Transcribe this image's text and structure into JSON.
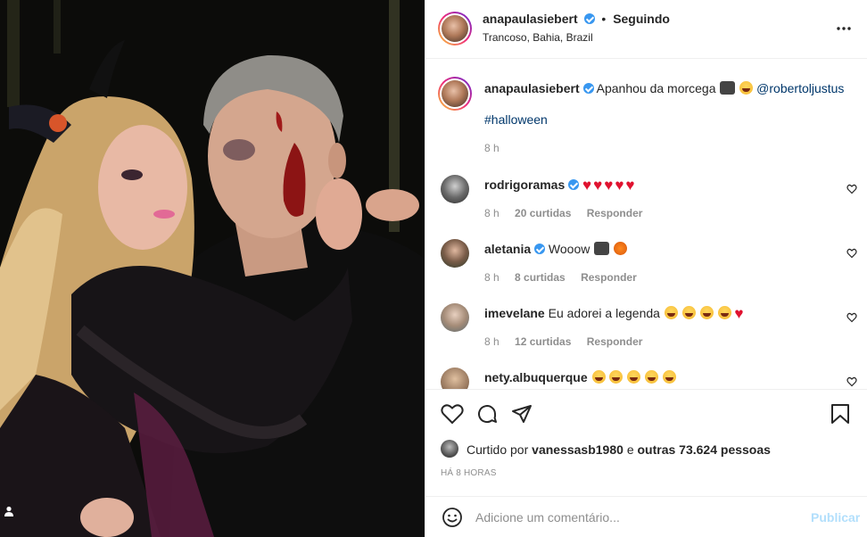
{
  "post": {
    "author": "anapaulasiebert",
    "follow_status": "Seguindo",
    "location": "Trancoso, Bahia, Brazil",
    "caption_text": "Apanhou da morcega",
    "caption_mention": "@robertoljustus",
    "caption_hashtag": "#halloween",
    "caption_time": "8 h"
  },
  "comments": [
    {
      "user": "rodrigoramas",
      "verified": true,
      "text": "",
      "emojis": [
        "red-heart",
        "red-heart",
        "red-heart",
        "red-heart",
        "red-heart"
      ],
      "time": "8 h",
      "likes": "20 curtidas",
      "reply": "Responder"
    },
    {
      "user": "aletania",
      "verified": true,
      "text": "Wooow",
      "emojis": [
        "bat",
        "pumpkin"
      ],
      "time": "8 h",
      "likes": "8 curtidas",
      "reply": "Responder"
    },
    {
      "user": "imevelane",
      "verified": false,
      "text": "Eu adorei a legenda",
      "emojis": [
        "laugh",
        "laugh",
        "laugh",
        "laugh",
        "red-heart"
      ],
      "time": "8 h",
      "likes": "12 curtidas",
      "reply": "Responder"
    },
    {
      "user": "nety.albuquerque",
      "verified": false,
      "text": "",
      "emojis": [
        "laugh",
        "laugh",
        "laugh",
        "laugh",
        "laugh"
      ]
    }
  ],
  "engagement": {
    "liked_by_prefix": "Curtido por",
    "liked_by_user": "vanessasb1980",
    "liked_by_suffix": "e",
    "others": "outras 73.624 pessoas",
    "time_ago": "HÁ 8 HORAS"
  },
  "composer": {
    "placeholder": "Adicione um comentário...",
    "publish": "Publicar"
  },
  "icons": {
    "more": "more-options-icon",
    "like": "heart-outline-icon",
    "comment": "comment-icon",
    "share": "send-icon",
    "save": "bookmark-icon",
    "emoji": "emoji-icon",
    "tagged": "user-tag-icon"
  },
  "colors": {
    "link": "#00376b",
    "verified": "#3897f0",
    "publish_disabled": "#b2dffc",
    "muted": "#8e8e8e"
  }
}
